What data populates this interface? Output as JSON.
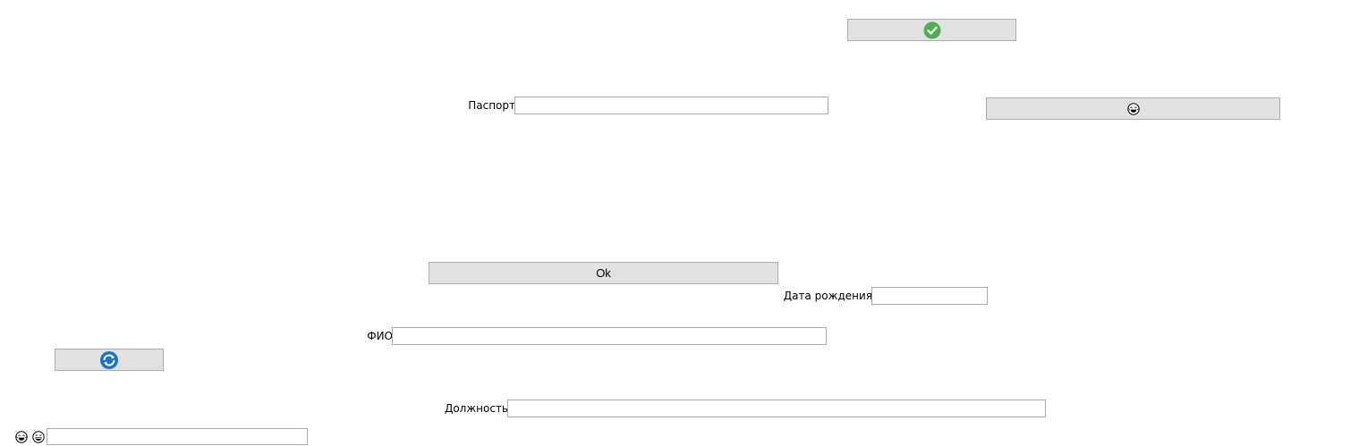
{
  "form": {
    "passport": {
      "label": "Паспорт",
      "value": ""
    },
    "birth_date": {
      "label": "Дата рождения",
      "value": ""
    },
    "full_name": {
      "label": "ФИО",
      "value": ""
    },
    "position": {
      "label": "Должность",
      "value": ""
    },
    "bottom_field": {
      "value": ""
    }
  },
  "buttons": {
    "confirm": {
      "icon": "check-circle-icon",
      "color": "#4caf50"
    },
    "emoji": {
      "icon": "laughing-face-icon"
    },
    "ok": {
      "label": "Ok"
    },
    "refresh": {
      "icon": "refresh-icon",
      "color": "#1e73c8"
    }
  },
  "bottom_icons": [
    "laughing-face-icon",
    "grinning-face-icon"
  ],
  "colors": {
    "button_bg": "#e1e1e1",
    "button_border": "#adadad",
    "field_border": "#a9a9a9"
  }
}
